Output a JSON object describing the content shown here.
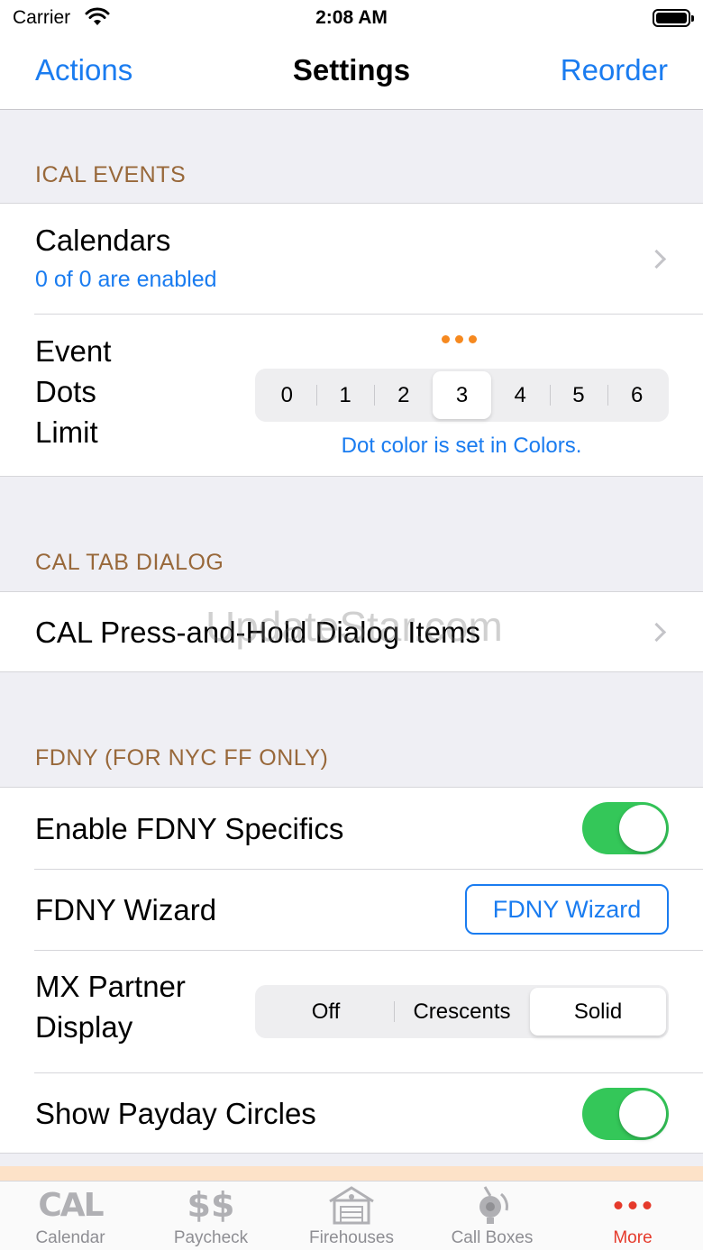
{
  "status_bar": {
    "carrier": "Carrier",
    "time": "2:08 AM"
  },
  "nav": {
    "left": "Actions",
    "title": "Settings",
    "right": "Reorder"
  },
  "sections": {
    "ical": {
      "header": "ICAL EVENTS",
      "calendars_title": "Calendars",
      "calendars_subtitle": "0 of 0 are enabled",
      "dots_label_1": "Event",
      "dots_label_2": "Dots",
      "dots_label_3": "Limit",
      "dots_options": [
        "0",
        "1",
        "2",
        "3",
        "4",
        "5",
        "6"
      ],
      "dots_selected": "3",
      "dots_note": "Dot color is set in Colors."
    },
    "cal_tab": {
      "header": "CAL TAB DIALOG",
      "row_title": "CAL Press-and-Hold Dialog Items"
    },
    "fdny": {
      "header": "FDNY (FOR NYC FF ONLY)",
      "enable_title": "Enable FDNY Specifics",
      "enable_on": true,
      "wizard_title": "FDNY Wizard",
      "wizard_button": "FDNY Wizard",
      "mx_label_1": "MX Partner",
      "mx_label_2": "Display",
      "mx_options": [
        "Off",
        "Crescents",
        "Solid"
      ],
      "mx_selected": "Solid",
      "payday_title": "Show Payday Circles",
      "payday_on": true
    }
  },
  "watermark": "UpdateStar.com",
  "tabs": [
    {
      "label": "Calendar",
      "icon": "cal-icon",
      "glyph": "CAL"
    },
    {
      "label": "Paycheck",
      "icon": "dollar-icon",
      "glyph": "$$"
    },
    {
      "label": "Firehouses",
      "icon": "firehouse-icon"
    },
    {
      "label": "Call Boxes",
      "icon": "call-box-icon"
    },
    {
      "label": "More",
      "icon": "more-dots-icon",
      "active": true
    }
  ],
  "colors": {
    "accent": "#1a7cf0",
    "section_header": "#98683a",
    "toggle_on": "#34c759",
    "dots": "#f6891f",
    "tab_active": "#e53a2b",
    "tab_inactive": "#8e8e93"
  }
}
